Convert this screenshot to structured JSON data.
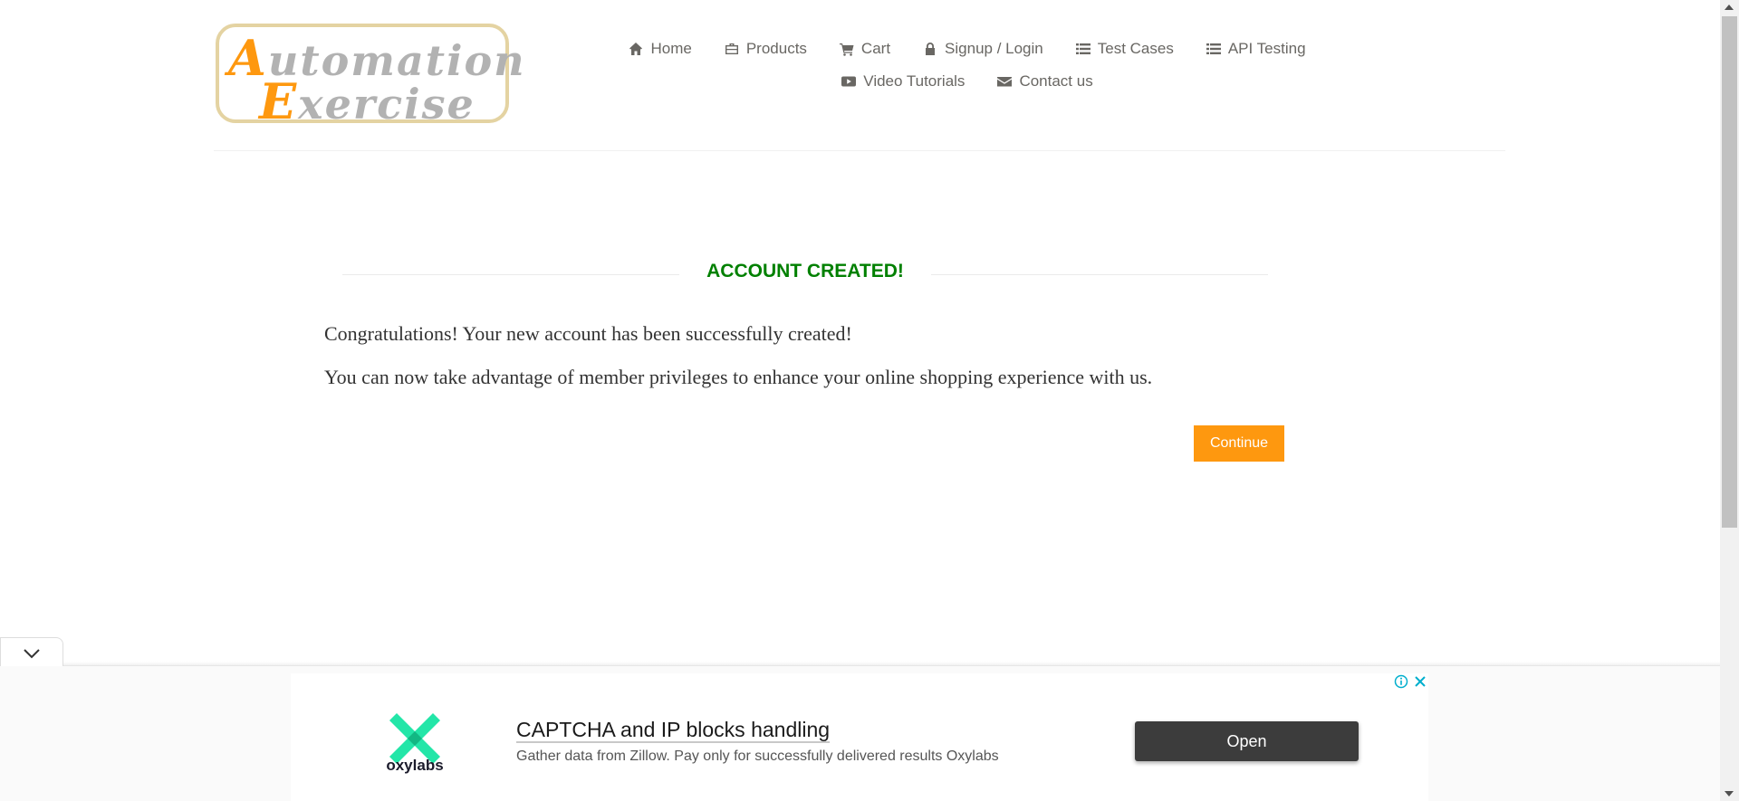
{
  "logo": {
    "line1_cap": "A",
    "line1_rest": "utomation",
    "line2_cap": "E",
    "line2_rest": "xercise"
  },
  "nav": {
    "row1": [
      {
        "label": "Home",
        "icon": "home-icon"
      },
      {
        "label": "Products",
        "icon": "briefcase-icon"
      },
      {
        "label": "Cart",
        "icon": "cart-icon"
      },
      {
        "label": "Signup / Login",
        "icon": "lock-icon"
      },
      {
        "label": "Test Cases",
        "icon": "list-icon"
      },
      {
        "label": "API Testing",
        "icon": "list-icon"
      }
    ],
    "row2": [
      {
        "label": "Video Tutorials",
        "icon": "youtube-play-icon"
      },
      {
        "label": "Contact us",
        "icon": "envelope-icon"
      }
    ]
  },
  "main": {
    "title": "ACCOUNT CREATED!",
    "message1": "Congratulations! Your new account has been successfully created!",
    "message2": "You can now take advantage of member privileges to enhance your online shopping experience with us.",
    "continue_label": "Continue"
  },
  "ad": {
    "brand": "oxylabs",
    "headline": "CAPTCHA and IP blocks handling",
    "description": "Gather data from Zillow. Pay only for successfully delivered results Oxylabs",
    "open_label": "Open"
  },
  "colors": {
    "accent": "#fe980f",
    "title_green": "#008000",
    "nav_text": "#696763",
    "ad_button": "#3c3c3c",
    "oxylabs_green": "#23e6a8"
  }
}
